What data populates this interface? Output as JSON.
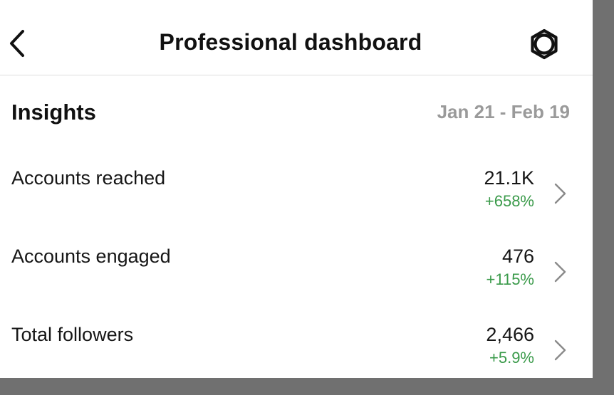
{
  "header": {
    "title": "Professional dashboard",
    "back_icon": "chevron-left-icon",
    "settings_icon": "gear-icon"
  },
  "insights": {
    "title": "Insights",
    "date_range": "Jan 21 - Feb 19",
    "rows": [
      {
        "label": "Accounts reached",
        "value": "21.1K",
        "change": "+658%"
      },
      {
        "label": "Accounts engaged",
        "value": "476",
        "change": "+115%"
      },
      {
        "label": "Total followers",
        "value": "2,466",
        "change": "+5.9%"
      }
    ]
  },
  "colors": {
    "positive_change": "#3a9a4a",
    "muted_text": "#9a9a9a",
    "primary_text": "#111111"
  }
}
